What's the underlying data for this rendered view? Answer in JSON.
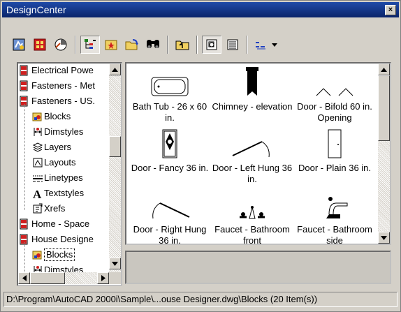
{
  "window": {
    "title": "DesignCenter",
    "close_glyph": "×"
  },
  "toolbar": {
    "buttons": [
      {
        "name": "desktop-icon"
      },
      {
        "name": "open-drawings-icon"
      },
      {
        "name": "history-icon"
      },
      {
        "name": "tree-view-toggle-icon",
        "pressed": true
      },
      {
        "name": "favorites-icon"
      },
      {
        "name": "load-icon"
      },
      {
        "name": "find-icon"
      },
      {
        "name": "up-icon"
      },
      {
        "name": "preview-icon",
        "pressed": true
      },
      {
        "name": "description-icon"
      },
      {
        "name": "views-icon"
      }
    ]
  },
  "tree": {
    "items": [
      {
        "label": "Electrical Powe",
        "icon": "drawing-icon"
      },
      {
        "label": "Fasteners - Met",
        "icon": "drawing-icon"
      },
      {
        "label": "Fasteners - US.",
        "icon": "drawing-icon"
      },
      {
        "label": "Blocks",
        "icon": "blocks-icon"
      },
      {
        "label": "Dimstyles",
        "icon": "dimstyles-icon"
      },
      {
        "label": "Layers",
        "icon": "layers-icon"
      },
      {
        "label": "Layouts",
        "icon": "layouts-icon"
      },
      {
        "label": "Linetypes",
        "icon": "linetypes-icon"
      },
      {
        "label": "Textstyles",
        "icon": "textstyles-icon"
      },
      {
        "label": "Xrefs",
        "icon": "xrefs-icon"
      },
      {
        "label": "Home - Space",
        "icon": "drawing-icon"
      },
      {
        "label": "House Designe",
        "icon": "drawing-icon"
      },
      {
        "label": "Blocks",
        "icon": "blocks-icon",
        "selected": true
      },
      {
        "label": "Dimstyles",
        "icon": "dimstyles-icon"
      }
    ]
  },
  "blocks": [
    {
      "label": "Bath Tub - 26 x 60 in.",
      "icon": "bath-tub-icon"
    },
    {
      "label": "Chimney - elevation",
      "icon": "chimney-icon"
    },
    {
      "label": "Door - Bifold 60 in. Opening",
      "icon": "door-bifold-icon"
    },
    {
      "label": "Door - Fancy 36 in.",
      "icon": "door-fancy-icon"
    },
    {
      "label": "Door - Left Hung 36 in.",
      "icon": "door-left-icon"
    },
    {
      "label": "Door - Plain 36 in.",
      "icon": "door-plain-icon"
    },
    {
      "label": "Door - Right Hung 36 in.",
      "icon": "door-right-icon"
    },
    {
      "label": "Faucet - Bathroom front",
      "icon": "faucet-front-icon"
    },
    {
      "label": "Faucet - Bathroom side",
      "icon": "faucet-side-icon"
    }
  ],
  "status": {
    "text": "D:\\Program\\AutoCAD 2000i\\Sample\\...ouse Designer.dwg\\Blocks (20 Item(s))"
  }
}
